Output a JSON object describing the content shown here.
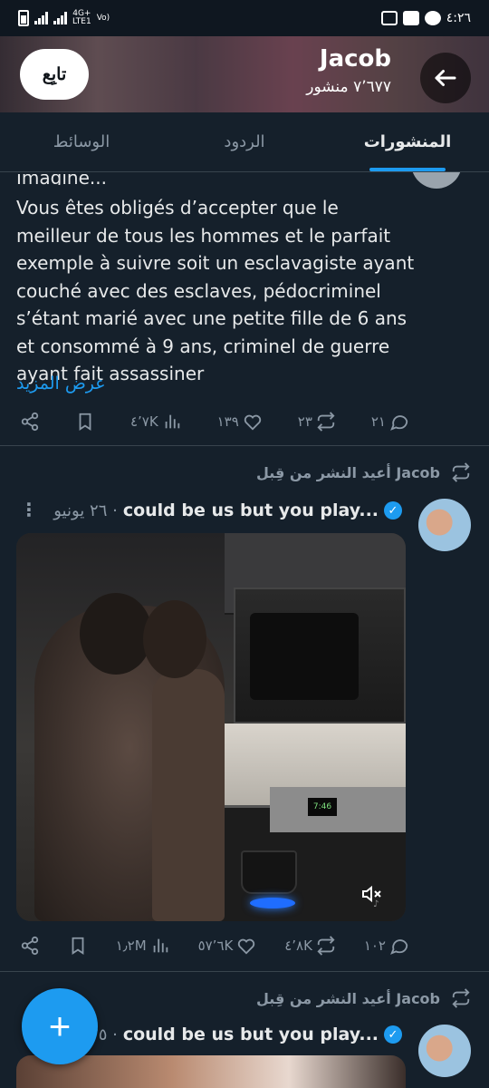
{
  "status_bar": {
    "time": "٤:٢٦",
    "network_top": "4G+",
    "network_bottom": "LTE1",
    "volte": "Vo)"
  },
  "header": {
    "name": "Jacob",
    "posts_count": "٧٬٦٧٧ منشور",
    "follow_label": "تابِع",
    "back_icon": "arrow-left-icon"
  },
  "tabs": [
    {
      "label": "المنشورات",
      "active": true
    },
    {
      "label": "الردود",
      "active": false
    },
    {
      "label": "الوسائط",
      "active": false
    }
  ],
  "post1": {
    "cut_line": "Imagine...",
    "text": "Vous êtes obligés d’accepter que le meilleur de tous les hommes et le parfait exemple à suivre soit un  esclavagiste ayant couché avec des esclaves, pédocriminel s’étant marié avec une petite fille de 6 ans et consommé à 9 ans, criminel de guerre ayant fait assassiner",
    "show_more": "عرض المزيد",
    "stats": {
      "replies": "٢١",
      "reposts": "٢٣",
      "likes": "١٣٩",
      "views": "٤٬٧K"
    }
  },
  "post2": {
    "repost_label": "أعيد النشر من قِبل Jacob",
    "author_name": "could be us but you play...",
    "date": "٢٦ يونيو ·",
    "stove_display": "7:46",
    "stats": {
      "replies": "١٠٢",
      "reposts": "٤٬٨K",
      "likes": "٥٧٬٦K",
      "views": "١٫٢M"
    }
  },
  "post3": {
    "repost_label": "أعيد النشر من قِبل Jacob",
    "author_name": "could be us but you play...",
    "date": "٢٥ ·"
  },
  "fab": {
    "label": "+"
  },
  "colors": {
    "background": "#15202b",
    "accent": "#1d9bf0",
    "muted": "#8b98a5",
    "divider": "#38444d"
  }
}
